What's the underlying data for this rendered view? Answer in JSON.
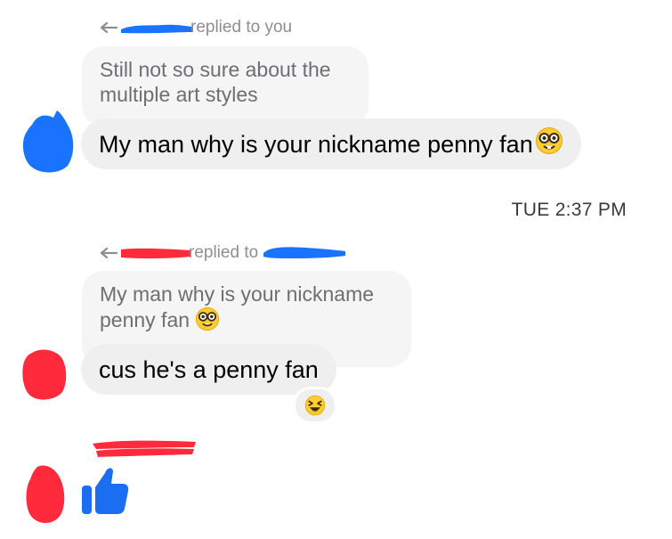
{
  "thread1": {
    "reply_header": "replied to you",
    "quoted_text": "Still not so sure about the multiple art styles",
    "message_text": "My man why is your nickname penny fan",
    "message_emoji": "nerd-face-emoji"
  },
  "timestamp": "TUE 2:37 PM",
  "thread2": {
    "reply_header": "replied to",
    "quoted_text": "My man why is your nickname penny fan",
    "quoted_emoji": "nerd-face-emoji",
    "message_text": "cus he's a penny fan",
    "reaction_emoji": "laughing-squint-emoji"
  },
  "thread3": {
    "like_icon": "thumbs-up-icon"
  },
  "colors": {
    "redaction_blue": "#1a73ff",
    "redaction_red": "#ff2a3c",
    "like_blue": "#1b6ef2",
    "bubble_gray": "#efeff0",
    "quote_gray": "#f5f5f5"
  }
}
